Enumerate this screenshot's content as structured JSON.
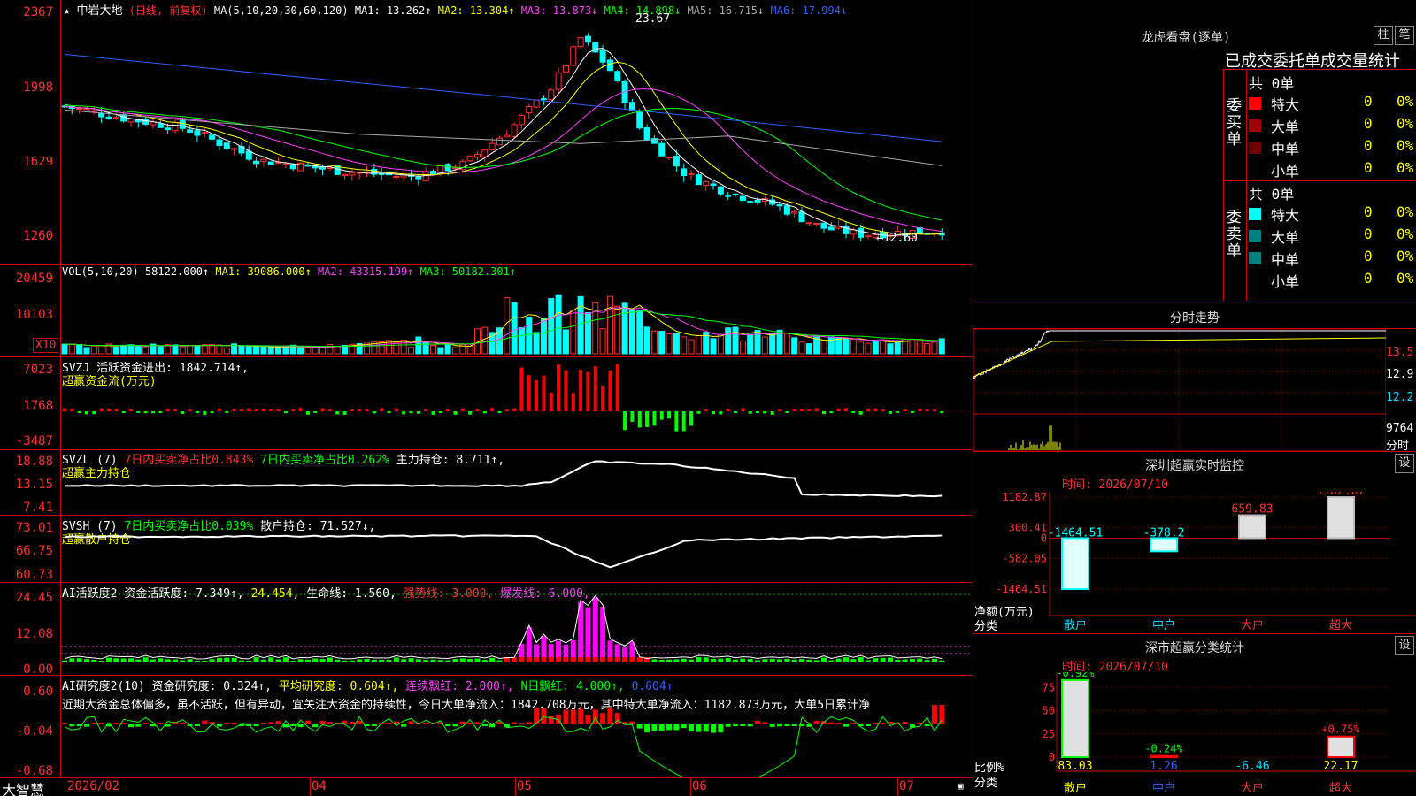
{
  "colors": {
    "up": "#ff3030",
    "down": "#00ffff",
    "grid": "#cc0000",
    "ma1": "#ffffff",
    "ma2": "#ffff00",
    "ma3": "#ff40ff",
    "ma4": "#00ff00",
    "ma5": "#aaaaaa",
    "ma6": "#3060ff"
  },
  "main": {
    "star": "★",
    "stock_name": "中岩大地",
    "mode": "(日线, 前复权)",
    "ma_params": "MA(5,10,20,30,60,120)",
    "ma1": "MA1: 13.262↑",
    "ma2": "MA2: 13.304↑",
    "ma3": "MA3: 13.873↓",
    "ma4": "MA4: 14.898↓",
    "ma5": "MA5: 16.715↓",
    "ma6": "MA6: 17.994↓",
    "y_ticks": [
      "2367",
      "1998",
      "1629",
      "1260"
    ],
    "high_label": "23.67",
    "low_label": "←12.60"
  },
  "vol": {
    "header_name": "VOL(5,10,20)",
    "value": "58122.000↑",
    "ma1": "MA1: 39086.000↑",
    "ma2": "MA2: 43315.199↑",
    "ma3": "MA3: 50182.301↑",
    "y_ticks": [
      "20459",
      "10103"
    ],
    "unit": "X10"
  },
  "svzj": {
    "line1": "SVZJ  活跃资金进出: 1842.714↑,",
    "line2": "超赢资金流(万元)",
    "y_ticks": [
      "7023",
      "1768",
      "-3487"
    ]
  },
  "svzl": {
    "name": "SVZL (7)",
    "a": "7日内买卖净占比0.843%",
    "b": "7日内买卖净占比0.262%",
    "c": "主力持仓: 8.711↑,",
    "line2": "超赢主力持仓",
    "y_ticks": [
      "18.88",
      "13.15",
      "7.41"
    ]
  },
  "svsh": {
    "name": "SVSH (7)",
    "a": "7日内买卖净占比0.039%",
    "c": "散户持仓: 71.527↓,",
    "line2": "超赢散户持仓",
    "y_ticks": [
      "73.01",
      "66.75",
      "60.73"
    ]
  },
  "ai1": {
    "name": "AI活跃度2",
    "a": "资金活跃度: 7.349↑,",
    "b": "24.454,",
    "c": "生命线: 1.560,",
    "d": "强势线: 3.000,",
    "e": "爆发线: 6.000,",
    "y_ticks": [
      "24.45",
      "12.08",
      "0.00"
    ]
  },
  "ai2": {
    "name": "AI研究度2(10)",
    "a": "资金研究度: 0.324↑,",
    "b": "平均研究度: 0.604↑,",
    "c": "连续飘红: 2.000↑,",
    "d": "N日飘红: 4.000↑,",
    "e": "0.604↑",
    "comment": "近期大资金总体偏多，虽不活跃，但有异动，宜关注大资金的持续性，今日大单净流入：1842.708万元，其中特大单净流入：1182.873万元，大单5日累计净",
    "y_ticks": [
      "0.60",
      "-0.04",
      "-0.68"
    ]
  },
  "bottom": {
    "brand": "大智慧",
    "dates": [
      "2026/02",
      "04",
      "05",
      "06",
      "07"
    ]
  },
  "lhb": {
    "title": "龙虎看盘(逐单)",
    "btn1": "柱",
    "btn2": "笔",
    "tabs": "已成交委托单成交量统计",
    "buy_label": "委买单",
    "sell_label": "委卖单",
    "buy_total": "共 0单",
    "sell_total": "共 0单",
    "buy_rows": [
      {
        "label": "特大",
        "value": "0",
        "pct": "0%",
        "color": "#ff0000"
      },
      {
        "label": "大单",
        "value": "0",
        "pct": "0%",
        "color": "#a00000"
      },
      {
        "label": "中单",
        "value": "0",
        "pct": "0%",
        "color": "#700000"
      },
      {
        "label": "小单",
        "value": "0",
        "pct": "0%",
        "color": ""
      }
    ],
    "sell_rows": [
      {
        "label": "特大",
        "value": "0",
        "pct": "0%",
        "color": "#00ffff"
      },
      {
        "label": "大单",
        "value": "0",
        "pct": "0%",
        "color": "#008080"
      },
      {
        "label": "中单",
        "value": "0",
        "pct": "0%",
        "color": "#008080"
      },
      {
        "label": "小单",
        "value": "0",
        "pct": "0%",
        "color": ""
      }
    ]
  },
  "fenshi": {
    "title": "分时走势",
    "prices": [
      "13.5",
      "12.9",
      "12.2"
    ],
    "vol": "9764",
    "vol_label": "分时"
  },
  "sz_monitor": {
    "title": "深圳超赢实时监控",
    "btn": "设",
    "time": "时间: 2026/07/10",
    "y_ticks": [
      "1182.87",
      "300.41",
      "0",
      "-582.05",
      "-1464.51"
    ],
    "y_title": "净额(万元)",
    "x_title": "分类",
    "bars": [
      {
        "cat": "散户",
        "value": -1464.51,
        "label": "-1464.51"
      },
      {
        "cat": "中户",
        "value": -378.2,
        "label": "-378.2"
      },
      {
        "cat": "大户",
        "value": 659.83,
        "label": "659.83"
      },
      {
        "cat": "超大",
        "value": 1182.87,
        "label": "1182.87"
      }
    ]
  },
  "sz_class": {
    "title": "深市超赢分类统计",
    "btn": "设",
    "time": "时间: 2026/07/10",
    "y_ticks": [
      "75",
      "50",
      "25",
      "0"
    ],
    "y_title": "比例%",
    "x_title": "分类",
    "bars": [
      {
        "cat": "散户",
        "ratio": 83.03,
        "change": "-0.92%",
        "value": "83.03"
      },
      {
        "cat": "中户",
        "ratio": 1.26,
        "change": "-0.24%",
        "value": "1.26"
      },
      {
        "cat": "大户",
        "ratio": -6.46,
        "change": "",
        "value": "-6.46"
      },
      {
        "cat": "超大",
        "ratio": 22.17,
        "change": "+0.75%",
        "value": "22.17"
      }
    ]
  }
}
